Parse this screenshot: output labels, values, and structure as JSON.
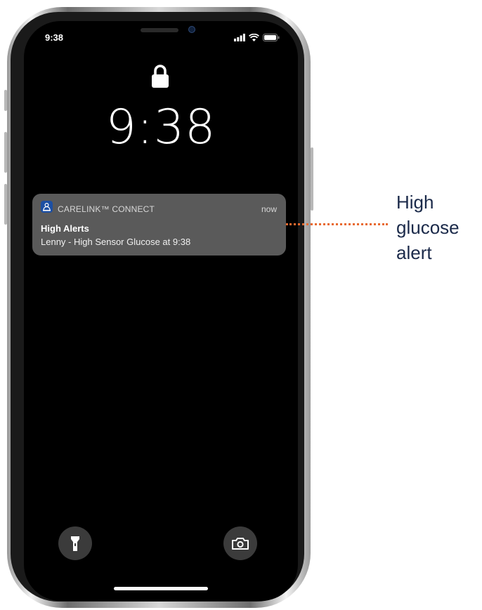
{
  "status_bar": {
    "time": "9:38"
  },
  "lock_screen": {
    "clock": "9:38"
  },
  "notification": {
    "app_name": "CARELINK™ CONNECT",
    "time": "now",
    "title": "High Alerts",
    "body": "Lenny - High Sensor Glucose at 9:38"
  },
  "callout": {
    "line1": "High",
    "line2": "glucose",
    "line3": "alert"
  },
  "colors": {
    "callout_line": "#e8692e",
    "callout_text": "#1b2a4a",
    "app_icon": "#1c4fa3"
  },
  "icons": {
    "lock": "lock-icon",
    "flashlight": "flashlight-icon",
    "camera": "camera-icon"
  }
}
